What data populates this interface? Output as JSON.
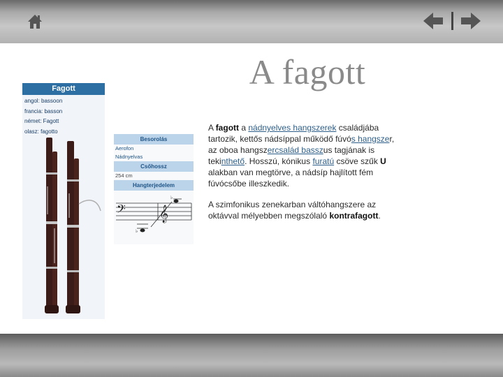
{
  "header": {
    "home_icon": "home-icon",
    "prev_icon": "arrow-left-icon",
    "next_icon": "arrow-right-icon"
  },
  "slide": {
    "title": "A fagott"
  },
  "infobox": {
    "title": "Fagott",
    "names": [
      "angol: bassoon",
      "francia: basson",
      "német: Fagott",
      "olasz: fagotto"
    ],
    "classification_header": "Besorolás",
    "classification": [
      "Aerofon",
      "Nádnyelvas"
    ],
    "tube_header": "Csőhossz",
    "tube_length": "254 cm",
    "range_header": "Hangterjedelem"
  },
  "paragraph1": {
    "t1": "A ",
    "b1": "fagott",
    "t2": " a ",
    "link1": "nádnyelves hangszerek",
    "t3": " családjába tartozik, kettős nádsíppal működő fúvó",
    "link2": "s hangsze",
    "t4": "r, az oboa hangsz",
    "link3": "ercsalád bassz",
    "t5": "us tagjának is teki",
    "link4": "nthető",
    "t6": ". Hosszú, kónikus ",
    "link5": "furatú",
    "t7": " csöve szűk ",
    "b2": "U",
    "t8": " alakban van megtörve, a nádsíp hajlított fém fúvócsőbe illeszkedik."
  },
  "paragraph2": {
    "t1": "A szimfonikus zenekarban váltóhangszere az oktávval mélyebben megszólaló ",
    "b1": "kontrafagott",
    "t2": "."
  }
}
